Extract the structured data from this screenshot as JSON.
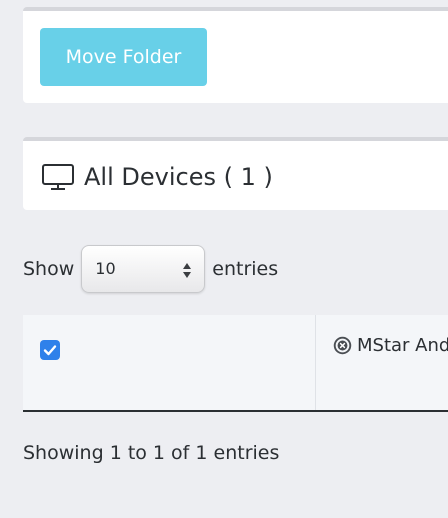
{
  "actions": {
    "move_folder_label": "Move Folder"
  },
  "devices_panel": {
    "icon": "monitor-icon",
    "title": "All Devices ( 1 )"
  },
  "length_control": {
    "prefix": "Show",
    "selected": "10",
    "suffix": "entries"
  },
  "table": {
    "rows": [
      {
        "checked": true,
        "remove_icon": "circle-x-icon",
        "device_name": "MStar Android TV"
      }
    ]
  },
  "info": {
    "text": "Showing 1 to 1 of 1 entries"
  },
  "colors": {
    "background": "#edeef2",
    "button": "#68d0e8",
    "checkbox": "#2f81ea",
    "text": "#2b2f33"
  }
}
